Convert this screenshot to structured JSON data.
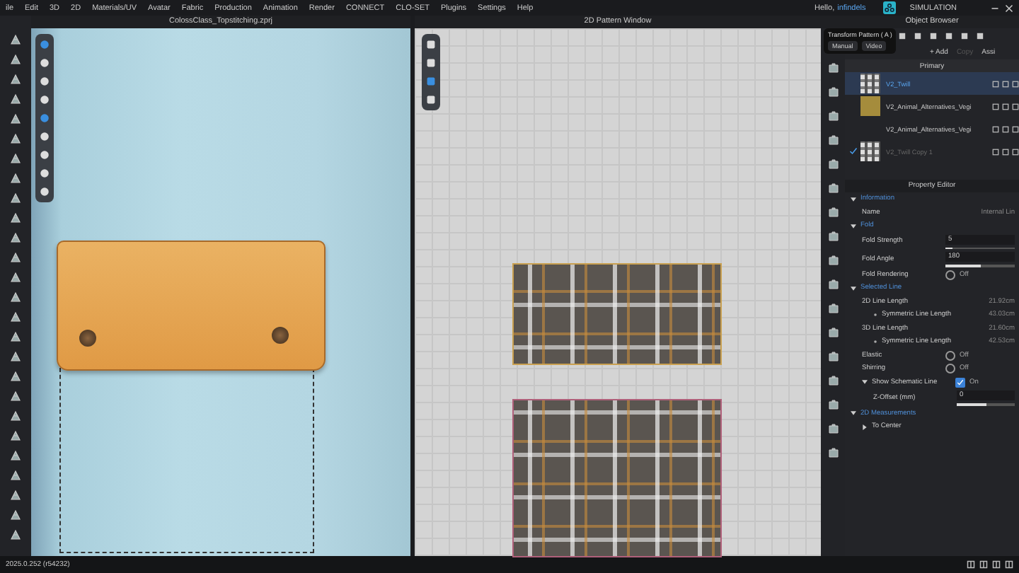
{
  "menu_bar": {
    "items": [
      "ile",
      "Edit",
      "3D",
      "2D",
      "Materials/UV",
      "Avatar",
      "Fabric",
      "Production",
      "Animation",
      "Render",
      "CONNECT",
      "CLO-SET",
      "Plugins",
      "Settings",
      "Help"
    ],
    "greeting": "Hello,",
    "username": "infindels",
    "mode": "SIMULATION"
  },
  "view_3d": {
    "title": "ColossClass_Topstitching.zprj"
  },
  "pattern_window": {
    "title": "2D Pattern Window"
  },
  "object_browser": {
    "title": "Object Browser",
    "tooltip": {
      "title": "Transform Pattern ( A )",
      "buttons": [
        "Manual",
        "Video"
      ]
    },
    "actions": [
      {
        "label": "+ Add",
        "disabled": false
      },
      {
        "label": "Copy",
        "disabled": true
      },
      {
        "label": "Assi",
        "disabled": false
      }
    ],
    "section": "Primary",
    "items": [
      {
        "name": "V2_Twill",
        "selected": true,
        "kind": "plaid",
        "checked": false,
        "disabled": false
      },
      {
        "name": "V2_Animal_Alternatives_Vegi",
        "selected": false,
        "kind": "solid",
        "color": "#a58c3c",
        "checked": false,
        "disabled": false
      },
      {
        "name": "V2_Animal_Alternatives_Vegi",
        "selected": false,
        "kind": "plain",
        "checked": false,
        "disabled": false
      },
      {
        "name": "V2_Twill Copy 1",
        "selected": false,
        "kind": "plaid",
        "checked": true,
        "disabled": true
      }
    ]
  },
  "property_editor": {
    "title": "Property Editor",
    "rows": [
      {
        "kind": "section",
        "label": "Information",
        "expanded": true,
        "children": [
          {
            "kind": "text",
            "label": "Name",
            "value": "Internal Lin"
          }
        ]
      },
      {
        "kind": "section",
        "label": "Fold",
        "expanded": true,
        "children": [
          {
            "kind": "slider",
            "label": "Fold Strength",
            "value": "5",
            "level": 0.1
          },
          {
            "kind": "slider",
            "label": "Fold Angle",
            "value": "180",
            "level": 0.5
          },
          {
            "kind": "toggle",
            "label": "Fold Rendering",
            "on": false,
            "value": "Off"
          }
        ]
      },
      {
        "kind": "section",
        "label": "Selected Line",
        "expanded": true,
        "children": [
          {
            "kind": "text",
            "label": "2D Line Length",
            "value": "21.92cm",
            "children": [
              {
                "kind": "text",
                "label": "Symmetric Line Length",
                "value": "43.03cm"
              }
            ]
          },
          {
            "kind": "text",
            "label": "3D Line Length",
            "value": "21.60cm",
            "children": [
              {
                "kind": "text",
                "label": "Symmetric Line Length",
                "value": "42.53cm"
              }
            ]
          },
          {
            "kind": "toggle",
            "label": "Elastic",
            "on": false,
            "value": "Off"
          },
          {
            "kind": "toggle",
            "label": "Shirring",
            "on": false,
            "value": "Off"
          },
          {
            "kind": "toggle",
            "label": "Show Schematic Line",
            "on": true,
            "value": "On",
            "expanded": true,
            "children": [
              {
                "kind": "slider",
                "label": "Z-Offset (mm)",
                "value": "0",
                "level": 0.5
              }
            ]
          }
        ]
      },
      {
        "kind": "section",
        "label": "2D Measurements",
        "expanded": true,
        "children": [
          {
            "kind": "group",
            "label": "To Center",
            "expanded": false
          }
        ]
      }
    ]
  },
  "status_bar": {
    "version": "2025.0.252 (r54232)"
  }
}
